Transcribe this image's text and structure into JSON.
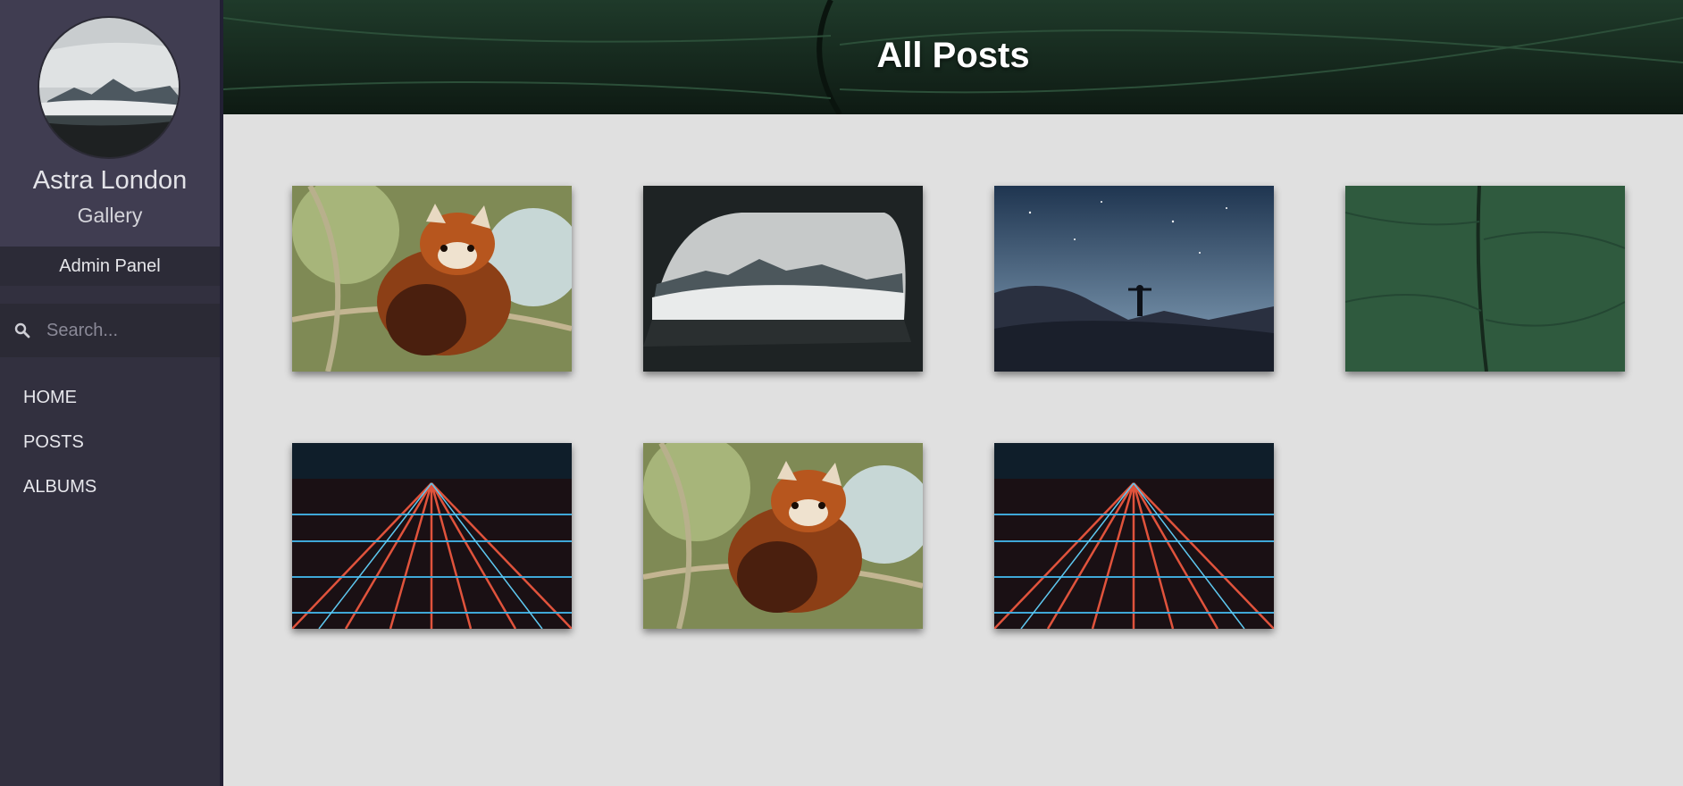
{
  "sidebar": {
    "site_name": "Astra London",
    "site_subtitle": "Gallery",
    "admin_label": "Admin Panel",
    "search_placeholder": "Search...",
    "nav": [
      "HOME",
      "POSTS",
      "ALBUMS"
    ]
  },
  "header": {
    "title": "All Posts"
  },
  "gallery": {
    "items": [
      {
        "subject": "red-panda"
      },
      {
        "subject": "car-window-mountains"
      },
      {
        "subject": "milky-way-hiker"
      },
      {
        "subject": "green-leaf"
      },
      {
        "subject": "city-lights"
      },
      {
        "subject": "red-panda"
      },
      {
        "subject": "city-lights"
      }
    ]
  },
  "colors": {
    "sidebar": "#32303f",
    "profile_bg": "#403d51",
    "content_bg": "#e0e0e0",
    "leaf_green": "#2f5a3e"
  }
}
